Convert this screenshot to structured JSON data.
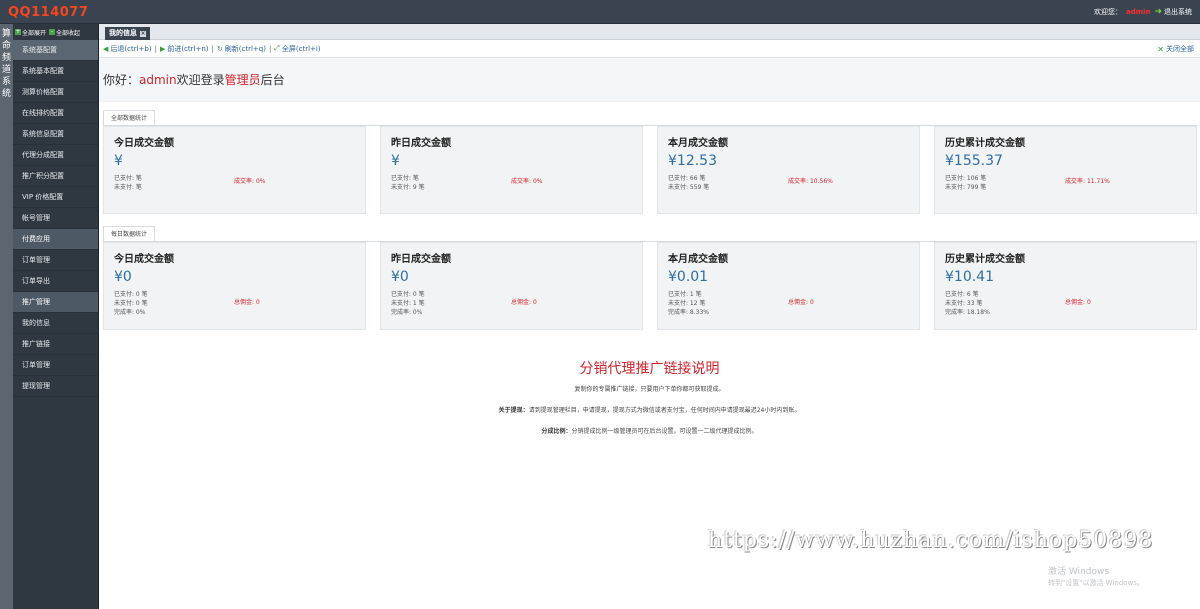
{
  "app": {
    "logo": "QQ114077"
  },
  "header": {
    "welcome_prefix": "欢迎您：",
    "username": "admin",
    "logout": "退出系统"
  },
  "rail": {
    "label": "算命频道系统"
  },
  "sidebar": {
    "expand_all": "全部展开",
    "collapse_all": "全部收起",
    "items": [
      {
        "label": "系统基配置",
        "state": "active"
      },
      {
        "label": "系统基本配置",
        "state": ""
      },
      {
        "label": "测算价格配置",
        "state": ""
      },
      {
        "label": "在线排约配置",
        "state": ""
      },
      {
        "label": "系统信息配置",
        "state": ""
      },
      {
        "label": "代理分成配置",
        "state": ""
      },
      {
        "label": "推广积分配置",
        "state": ""
      },
      {
        "label": "VIP 价格配置",
        "state": ""
      },
      {
        "label": "帐号管理",
        "state": ""
      },
      {
        "label": "付费应用",
        "state": "section"
      },
      {
        "label": "订单管理",
        "state": ""
      },
      {
        "label": "订单导出",
        "state": ""
      },
      {
        "label": "推广管理",
        "state": "section"
      },
      {
        "label": "我的信息",
        "state": ""
      },
      {
        "label": "推广链接",
        "state": ""
      },
      {
        "label": "订单管理",
        "state": ""
      },
      {
        "label": "提现管理",
        "state": ""
      }
    ]
  },
  "tabs": [
    {
      "label": "我的信息"
    }
  ],
  "toolbar": {
    "back": "后退(ctrl+b)",
    "forward": "前进(ctrl+n)",
    "refresh": "刷新(ctrl+q)",
    "fullscreen": "全屏(ctrl+i)",
    "sep": "|",
    "close_all": "关闭全部"
  },
  "welcome": {
    "prefix": "你好：",
    "user": "admin",
    "middle": "欢迎登录",
    "role": "管理员",
    "suffix": "后台"
  },
  "total_stats": {
    "tab": "全部数据统计",
    "cards": [
      {
        "title": "今日成交金额",
        "amount": "¥",
        "paid": "已支付: 笔",
        "unpaid": "未支付: 笔",
        "rate_label": "成交率:",
        "rate": "0%"
      },
      {
        "title": "昨日成交金额",
        "amount": "¥",
        "paid": "已支付: 笔",
        "unpaid": "未支付: 9 笔",
        "rate_label": "成交率:",
        "rate": "0%"
      },
      {
        "title": "本月成交金额",
        "amount": "¥12.53",
        "paid": "已支付: 66 笔",
        "unpaid": "未支付: 559 笔",
        "rate_label": "成交率:",
        "rate": "10.56%"
      },
      {
        "title": "历史累计成交金额",
        "amount": "¥155.37",
        "paid": "已支付: 106 笔",
        "unpaid": "未支付: 799 笔",
        "rate_label": "成交率:",
        "rate": "11.71%"
      }
    ]
  },
  "daily_stats": {
    "tab": "每日数据统计",
    "cards": [
      {
        "title": "今日成交金额",
        "amount": "¥0",
        "paid": "已支付: 0 笔",
        "unpaid": "未支付: 0 笔",
        "done": "完成率: 0%",
        "comm_label": "总佣金:",
        "comm": "0"
      },
      {
        "title": "昨日成交金额",
        "amount": "¥0",
        "paid": "已支付: 0 笔",
        "unpaid": "未支付: 1 笔",
        "done": "完成率: 0%",
        "comm_label": "总佣金:",
        "comm": "0"
      },
      {
        "title": "本月成交金额",
        "amount": "¥0.01",
        "paid": "已支付: 1 笔",
        "unpaid": "未支付: 12 笔",
        "done": "完成率: 8.33%",
        "comm_label": "总佣金:",
        "comm": "0"
      },
      {
        "title": "历史累计成交金额",
        "amount": "¥10.41",
        "paid": "已支付: 6 笔",
        "unpaid": "未支付: 33 笔",
        "done": "完成率: 18.18%",
        "comm_label": "总佣金:",
        "comm": "0"
      }
    ]
  },
  "description": {
    "title": "分销代理推广链接说明",
    "line1": "复制你的专属推广链接，只要用户下单你都可获取提成。",
    "withdraw_label": "关于提现：",
    "withdraw_text": "请到提现管理栏目，申请提现，提现方式为微信或者支付宝，任何时间内申请提现最迟24小时内到账。",
    "ratio_label": "分成比例：",
    "ratio_text": "分销提成比例一级管理员可在后台设置，可设置一二级代理提成比例。"
  },
  "overlay": {
    "watermark": "https://www.huzhan.com/ishop50898",
    "activate_title": "激活 Windows",
    "activate_sub": "转到\"设置\"以激活 Windows。"
  },
  "colors": {
    "accent_red": "#d2232a",
    "amount_blue": "#2e6ea6",
    "sidebar_bg": "#2f3841",
    "topbar_bg": "#3a4350"
  }
}
